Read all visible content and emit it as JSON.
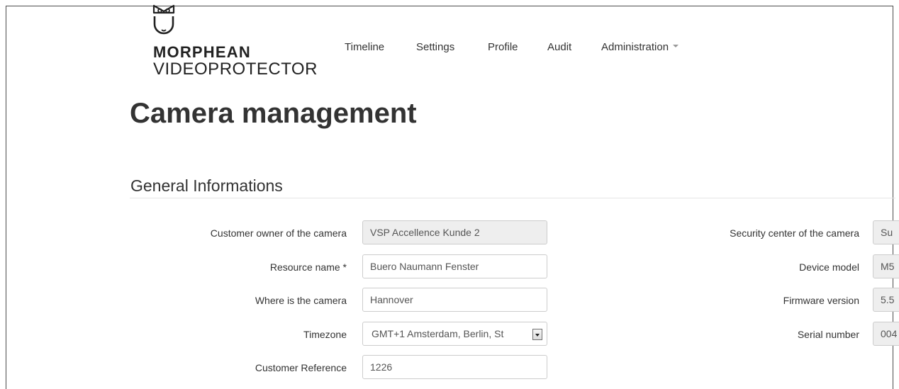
{
  "brand": {
    "line1": "MORPHEAN",
    "line2": "VIDEOPROTECTOR",
    "logo_icon": "owl-icon"
  },
  "nav": {
    "items": [
      {
        "label": "Timeline"
      },
      {
        "label": "Settings"
      },
      {
        "label": "Profile"
      },
      {
        "label": "Audit"
      },
      {
        "label": "Administration",
        "has_dropdown": true
      }
    ]
  },
  "page": {
    "title": "Camera management"
  },
  "section": {
    "title": "General Informations"
  },
  "form_left": {
    "customer_owner": {
      "label": "Customer owner of the camera",
      "value": "VSP Accellence Kunde 2"
    },
    "resource_name": {
      "label": "Resource name *",
      "value": "Buero Naumann Fenster"
    },
    "location": {
      "label": "Where is the camera",
      "value": "Hannover"
    },
    "timezone": {
      "label": "Timezone",
      "value": "GMT+1 Amsterdam, Berlin, St"
    },
    "customer_reference": {
      "label": "Customer Reference",
      "value": "1226"
    }
  },
  "form_right": {
    "security_center": {
      "label": "Security center of the camera",
      "value": "Su"
    },
    "device_model": {
      "label": "Device model",
      "value": "M5"
    },
    "firmware_version": {
      "label": "Firmware version",
      "value": "5.5"
    },
    "serial_number": {
      "label": "Serial number",
      "value": "004"
    }
  },
  "colors": {
    "text": "#333333",
    "readonly_bg": "#eeeeee",
    "input_border": "#cccccc",
    "rule": "#e5e5e5"
  }
}
